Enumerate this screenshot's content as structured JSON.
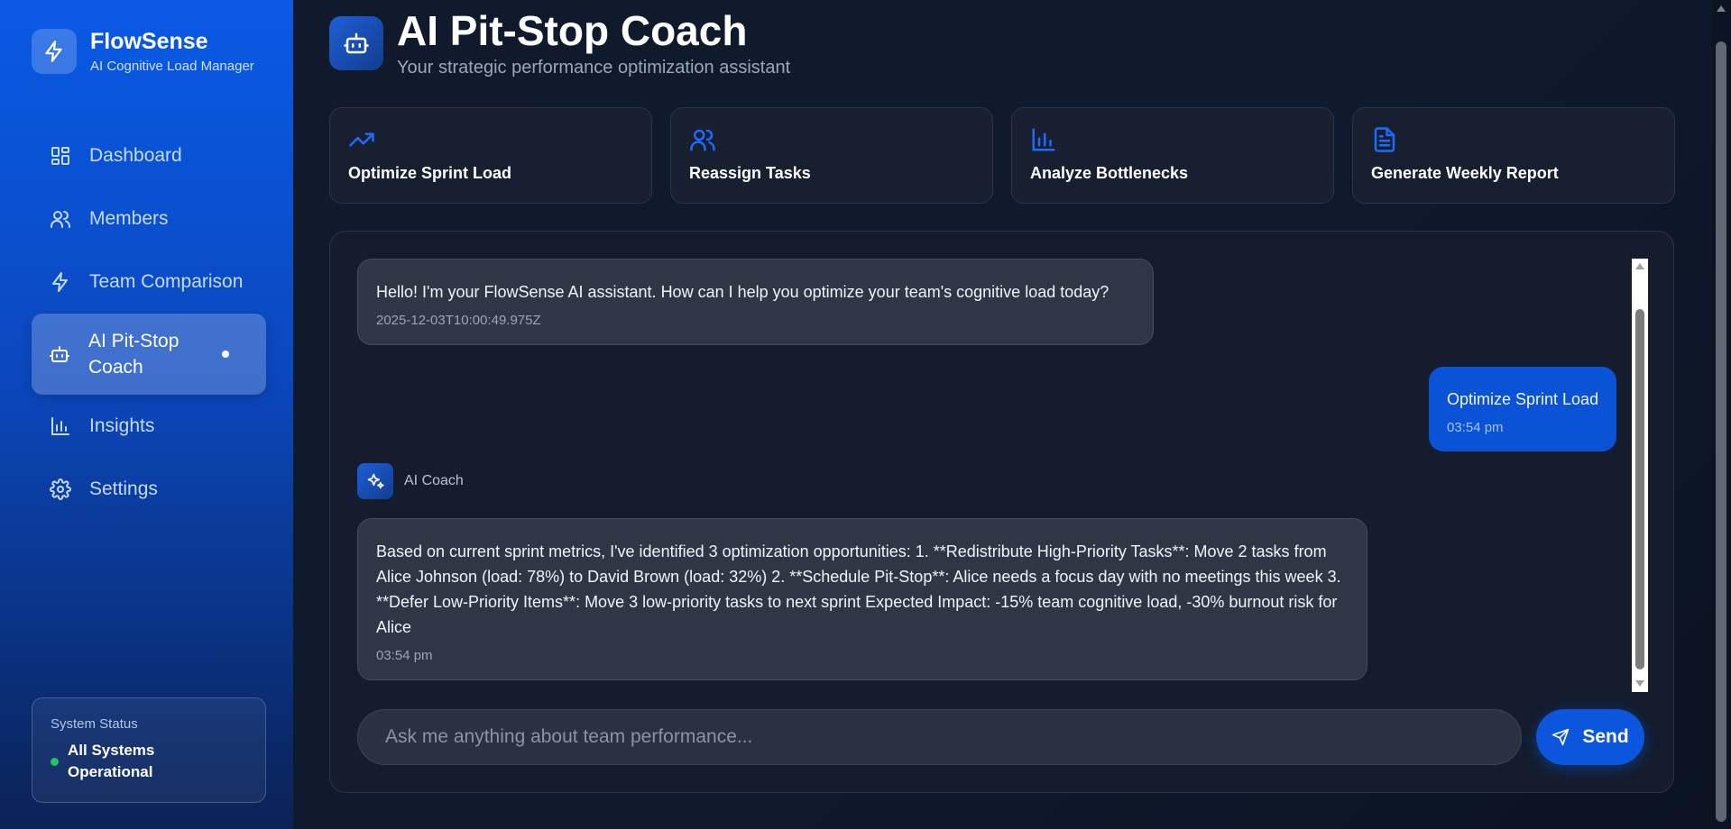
{
  "brand": {
    "name": "FlowSense",
    "subtitle": "AI Cognitive Load Manager",
    "icon": "bolt-icon"
  },
  "nav": {
    "items": [
      {
        "label": "Dashboard",
        "icon": "dashboard-icon"
      },
      {
        "label": "Members",
        "icon": "users-icon"
      },
      {
        "label": "Team Comparison",
        "icon": "bolt-icon"
      },
      {
        "label": "AI Pit-Stop Coach",
        "icon": "bot-icon",
        "active": true
      },
      {
        "label": "Insights",
        "icon": "bar-chart-icon"
      },
      {
        "label": "Settings",
        "icon": "gear-icon"
      }
    ]
  },
  "system_status": {
    "label": "System Status",
    "value": "All Systems Operational",
    "color": "#22c55e"
  },
  "header": {
    "title": "AI Pit-Stop Coach",
    "subtitle": "Your strategic performance optimization assistant",
    "icon": "bot-icon"
  },
  "quick_actions": [
    {
      "label": "Optimize Sprint Load",
      "icon": "trending-up-icon"
    },
    {
      "label": "Reassign Tasks",
      "icon": "users-icon"
    },
    {
      "label": "Analyze Bottlenecks",
      "icon": "bar-chart-icon"
    },
    {
      "label": "Generate Weekly Report",
      "icon": "document-icon"
    }
  ],
  "messages": [
    {
      "role": "assistant",
      "text": "Hello! I'm your FlowSense AI assistant. How can I help you optimize your team's cognitive load today?",
      "time": "2025-12-03T10:00:49.975Z"
    },
    {
      "role": "user",
      "text": "Optimize Sprint Load",
      "time": "03:54 pm"
    },
    {
      "role": "assistant",
      "sender": "AI Coach",
      "text": "Based on current sprint metrics, I've identified 3 optimization opportunities: 1. **Redistribute High-Priority Tasks**: Move 2 tasks from Alice Johnson (load: 78%) to David Brown (load: 32%) 2. **Schedule Pit-Stop**: Alice needs a focus day with no meetings this week 3. **Defer Low-Priority Items**: Move 3 low-priority tasks to next sprint Expected Impact: -15% team cognitive load, -30% burnout risk for Alice",
      "time": "03:54 pm"
    }
  ],
  "composer": {
    "placeholder": "Ask me anything about team performance...",
    "value": "",
    "send_label": "Send"
  },
  "colors": {
    "accent": "#0b56dc",
    "sidebar_top": "#0a5ae6",
    "background": "#0f1a2e"
  }
}
